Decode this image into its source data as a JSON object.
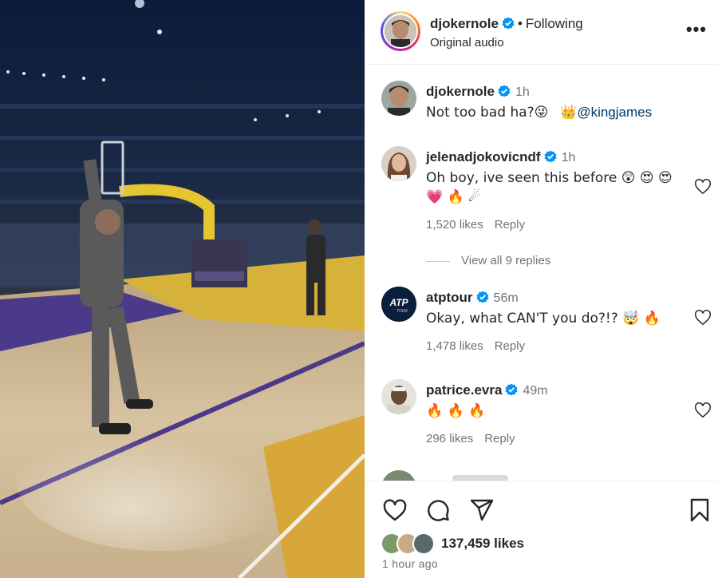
{
  "header": {
    "username": "djokernole",
    "separator": "•",
    "following": "Following",
    "audio": "Original audio",
    "more": "•••"
  },
  "comments": [
    {
      "username": "djokernole",
      "time": "1h",
      "text": "Not too bad ha?😜",
      "crown": "👑",
      "mention": "@kingjames",
      "avatar": "player-avatar",
      "verified": true
    },
    {
      "username": "jelenadjokovicndf",
      "time": "1h",
      "text": "Oh boy, ive seen this before 😲 😍 😍",
      "text_line2": "💗 🔥 ☄",
      "likes": "1,520 likes",
      "reply": "Reply",
      "view_replies": "View all 9 replies",
      "avatar": "woman-avatar",
      "verified": true
    },
    {
      "username": "atptour",
      "time": "56m",
      "text": "Okay, what CAN'T you do?!? 🤯 🔥",
      "likes": "1,478 likes",
      "reply": "Reply",
      "avatar": "atp-logo-avatar",
      "logo_text": "ATP",
      "logo_sub": "TOUR",
      "verified": true
    },
    {
      "username": "patrice.evra",
      "time": "49m",
      "text": "🔥 🔥 🔥",
      "likes": "296 likes",
      "reply": "Reply",
      "avatar": "man-avatar",
      "verified": true
    }
  ],
  "actions": {
    "like_icon": "heart-icon",
    "comment_icon": "comment-icon",
    "share_icon": "share-icon",
    "save_icon": "bookmark-icon"
  },
  "likes_total": "137,459 likes",
  "posted": "1 hour ago",
  "colors": {
    "verified": "#0095f6",
    "muted": "#737373",
    "mention": "#00376b"
  }
}
